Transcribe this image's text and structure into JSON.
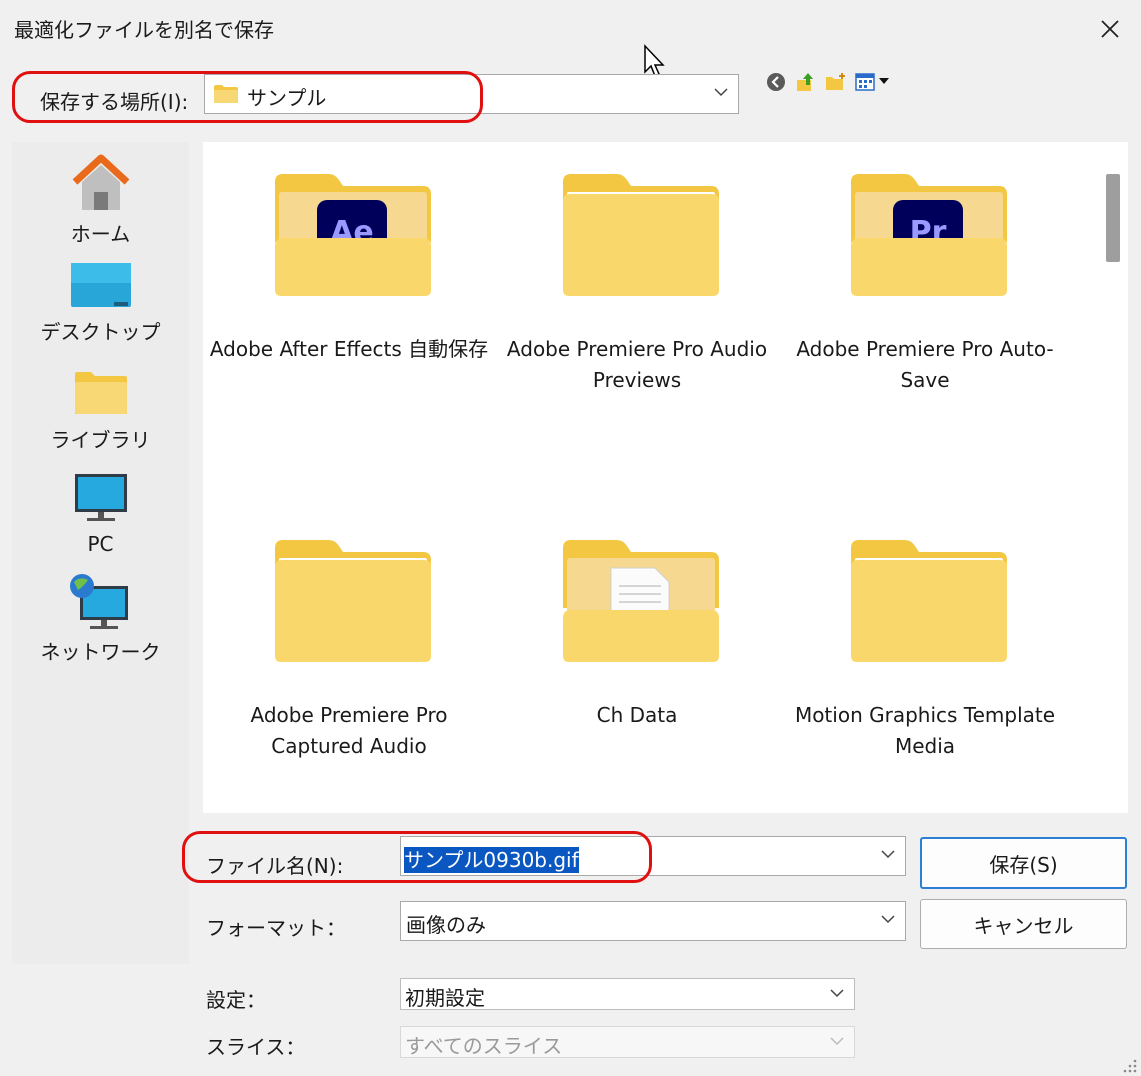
{
  "window": {
    "title": "最適化ファイルを別名で保存"
  },
  "location": {
    "label": "保存する場所(I):",
    "value": "サンプル"
  },
  "places": [
    {
      "label": "ホーム",
      "icon": "home-icon"
    },
    {
      "label": "デスクトップ",
      "icon": "desktop-icon"
    },
    {
      "label": "ライブラリ",
      "icon": "library-folder-icon"
    },
    {
      "label": "PC",
      "icon": "pc-monitor-icon"
    },
    {
      "label": "ネットワーク",
      "icon": "network-icon"
    }
  ],
  "files": [
    {
      "name": "Adobe After Effects 自動保存",
      "badge": "Ae",
      "badge_color": "#9999ff"
    },
    {
      "name": "Adobe Premiere Pro Audio Previews"
    },
    {
      "name": "Adobe Premiere Pro Auto-Save",
      "badge": "Pr",
      "badge_color": "#9999ff"
    },
    {
      "name": "Adobe Premiere Pro Captured Audio"
    },
    {
      "name": "Ch Data"
    },
    {
      "name": "Motion Graphics Template Media"
    }
  ],
  "form": {
    "filename_label": "ファイル名(N):",
    "filename_value": "サンプル0930b.gif",
    "format_label": "フォーマット：",
    "format_value": "画像のみ",
    "settings_label": "設定：",
    "settings_value": "初期設定",
    "slices_label": "スライス：",
    "slices_value": "すべてのスライス"
  },
  "buttons": {
    "save": "保存(S)",
    "cancel": "キャンセル"
  },
  "colors": {
    "highlight_outline": "#e01010",
    "selection": "#0a57c2",
    "folder": "#f8d775"
  }
}
